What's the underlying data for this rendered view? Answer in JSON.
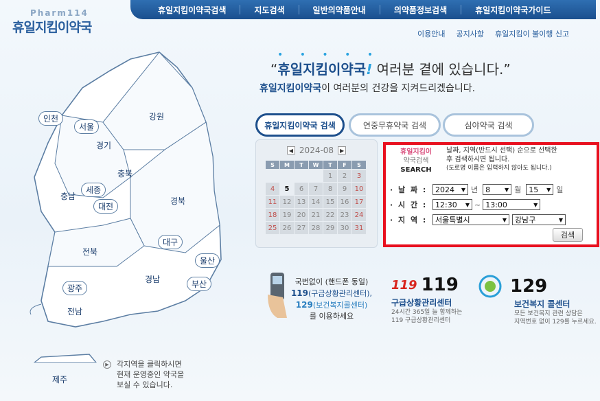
{
  "logo": {
    "sub": "Pharm114",
    "main": "휴일지킴이약국"
  },
  "topnav": [
    {
      "label": "휴일지킴이약국검색"
    },
    {
      "label": "지도검색"
    },
    {
      "label": "일반의약품안내"
    },
    {
      "label": "의약품정보검색"
    },
    {
      "label": "휴일지킴이약국가이드"
    }
  ],
  "utility_links": [
    "이용안내",
    "공지사항",
    "휴일지킴이 불이행 신고"
  ],
  "headline": {
    "dots": "• • • • •",
    "open_quote": "“",
    "highlight": "휴일지킴이약국",
    "excl": "!",
    "rest": " 여러분 곁에 있습니다.”"
  },
  "subline": {
    "highlight": "휴일지킴이약국",
    "rest": "이 여러분의 건강을 지켜드리겠습니다."
  },
  "tabs": [
    {
      "label": "휴일지킴이약국 검색",
      "active": true
    },
    {
      "label": "연중무휴약국 검색",
      "active": false
    },
    {
      "label": "심야약국 검색",
      "active": false
    }
  ],
  "calendar": {
    "month_label": "2024-08",
    "dow": [
      "S",
      "M",
      "T",
      "W",
      "T",
      "F",
      "S"
    ],
    "today": "5",
    "weeks": [
      [
        "",
        "",
        "",
        "",
        "1",
        "2",
        "3"
      ],
      [
        "4",
        "5",
        "6",
        "7",
        "8",
        "9",
        "10"
      ],
      [
        "11",
        "12",
        "13",
        "14",
        "15",
        "16",
        "17"
      ],
      [
        "18",
        "19",
        "20",
        "21",
        "22",
        "23",
        "24"
      ],
      [
        "25",
        "26",
        "27",
        "28",
        "29",
        "30",
        "31"
      ]
    ]
  },
  "search_box": {
    "title1": "휴일지킴이",
    "title2": "약국검색",
    "title3": "SEARCH",
    "desc1": "날짜, 지역(반드시 선택) 순으로 선택한",
    "desc2": "후 검색하시면 됩니다.",
    "desc3": "(도로명 이름은 입력하지 않아도 됩니다.)",
    "date_label": "· 날 짜 :",
    "year": "2024",
    "year_unit": "년",
    "month": "8",
    "month_unit": "월",
    "day": "15",
    "day_unit": "일",
    "time_label": "· 시 간 :",
    "time_from": "12:30",
    "time_sep": "~",
    "time_to": "13:00",
    "region_label": "· 지 역 :",
    "region_city": "서울특별시",
    "region_district": "강남구",
    "search_button": "검색"
  },
  "phone_info": {
    "line1": "국번없이 (핸드폰 동일)",
    "line2_num": "119",
    "line2_rest": "(구급상황관리센터),",
    "line3_num": "129",
    "line3_rest": "(보건복지콜센터)",
    "line4": "를 이용하세요"
  },
  "center119": {
    "logo_text": "119",
    "number": "119",
    "name": "구급상황관리센터",
    "desc1": "24시간 365일 늘 함께하는",
    "desc2": "119 구급상황관리센터"
  },
  "center129": {
    "number": "129",
    "name": "보건복지 콜센터",
    "desc1": "모든 보건복지 관련 상담은",
    "desc2": "지역번호 없이 129를 누르세요."
  },
  "map_regions": [
    "인천",
    "서울",
    "경기",
    "강원",
    "충북",
    "세종",
    "충남",
    "대전",
    "경북",
    "대구",
    "전북",
    "울산",
    "경남",
    "광주",
    "부산",
    "전남",
    "제주"
  ],
  "map_hint": {
    "line1": "각지역을 클릭하시면",
    "line2": "현재 운영중인 약국을",
    "line3": "보실 수 있습니다."
  },
  "colors": {
    "brand": "#1d4f8c",
    "nav_bg": "#2f6fb2",
    "highlight_border": "#e8101f"
  }
}
